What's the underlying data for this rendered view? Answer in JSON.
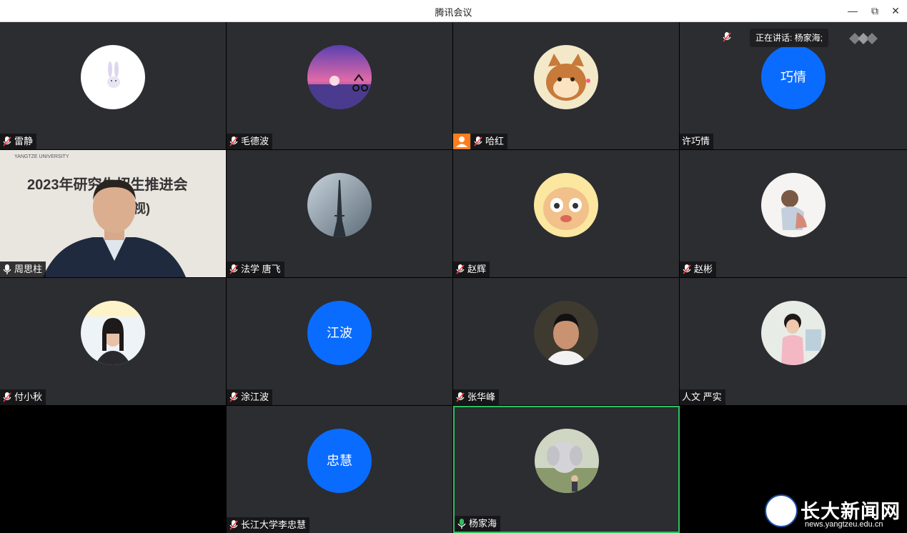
{
  "window": {
    "title": "腾讯会议",
    "minimize": "—",
    "restore": "⧉",
    "close": "✕"
  },
  "speaking": {
    "label": "正在讲话: 杨家海;"
  },
  "participants": [
    {
      "name": "雷静",
      "avatar_text": "",
      "mic": "muted"
    },
    {
      "name": "毛德波",
      "avatar_text": "",
      "mic": "muted"
    },
    {
      "name": "哈红",
      "avatar_text": "",
      "mic": "muted",
      "host": true
    },
    {
      "name": "许巧情",
      "avatar_text": "巧情",
      "mic": "none"
    },
    {
      "name": "周思柱",
      "avatar_text": "",
      "mic": "on",
      "video": true
    },
    {
      "name": "法学 唐飞",
      "avatar_text": "",
      "mic": "muted"
    },
    {
      "name": "赵辉",
      "avatar_text": "",
      "mic": "muted"
    },
    {
      "name": "赵彬",
      "avatar_text": "",
      "mic": "muted"
    },
    {
      "name": "付小秋",
      "avatar_text": "",
      "mic": "muted"
    },
    {
      "name": "涂江波",
      "avatar_text": "江波",
      "mic": "muted"
    },
    {
      "name": "张华峰",
      "avatar_text": "",
      "mic": "muted"
    },
    {
      "name": "人文 严实",
      "avatar_text": "",
      "mic": "none"
    },
    {
      "name": "长江大学李忠慧",
      "avatar_text": "忠慧",
      "mic": "muted"
    },
    {
      "name": "杨家海",
      "avatar_text": "",
      "mic": "on",
      "active": true
    }
  ],
  "video_feed": {
    "banner": "2023年研究生招生推进会",
    "banner_suffix": "(视)",
    "university": "YANGTZE UNIVERSITY"
  },
  "watermark": {
    "text": "长大新闻网",
    "url": "news.yangtzeu.edu.cn"
  },
  "colors": {
    "tile_bg": "#2b2d31",
    "avatar_blue": "#0a6cff",
    "active_border": "#2fbf5f",
    "host_orange": "#ff7d1a"
  }
}
